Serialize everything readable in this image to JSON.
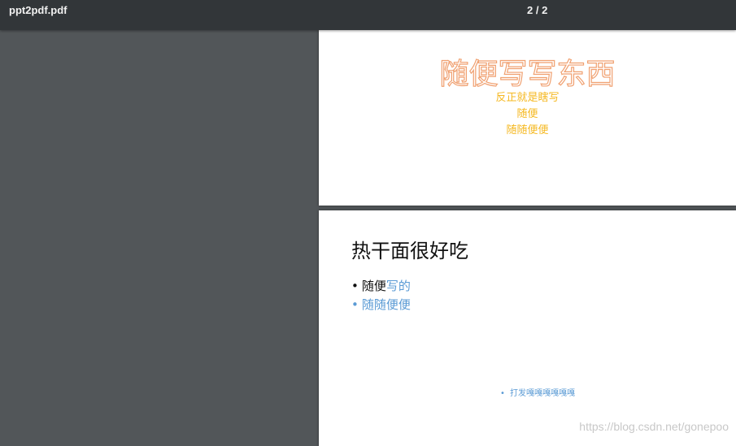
{
  "toolbar": {
    "file_name": "ppt2pdf.pdf",
    "page_indicator": "2 / 2"
  },
  "page1": {
    "title": "随便写写东西",
    "lines": [
      "反正就是瞎写",
      "随便",
      "随随便便"
    ]
  },
  "page2": {
    "heading": "热干面很好吃",
    "bullet1_plain": "随便",
    "bullet1_highlight": "写的",
    "bullet2": "随随便便",
    "footnote": "打发嘎嘎嘎嘎嘎嘎",
    "bullet_char": "•"
  },
  "watermark": "https://blog.csdn.net/gonepoo",
  "colors": {
    "toolbar_bg": "#323639",
    "viewer_bg": "#525659",
    "title_outline": "#f0a070",
    "subtitle": "#f5b820",
    "accent_blue": "#5b9bd5"
  }
}
